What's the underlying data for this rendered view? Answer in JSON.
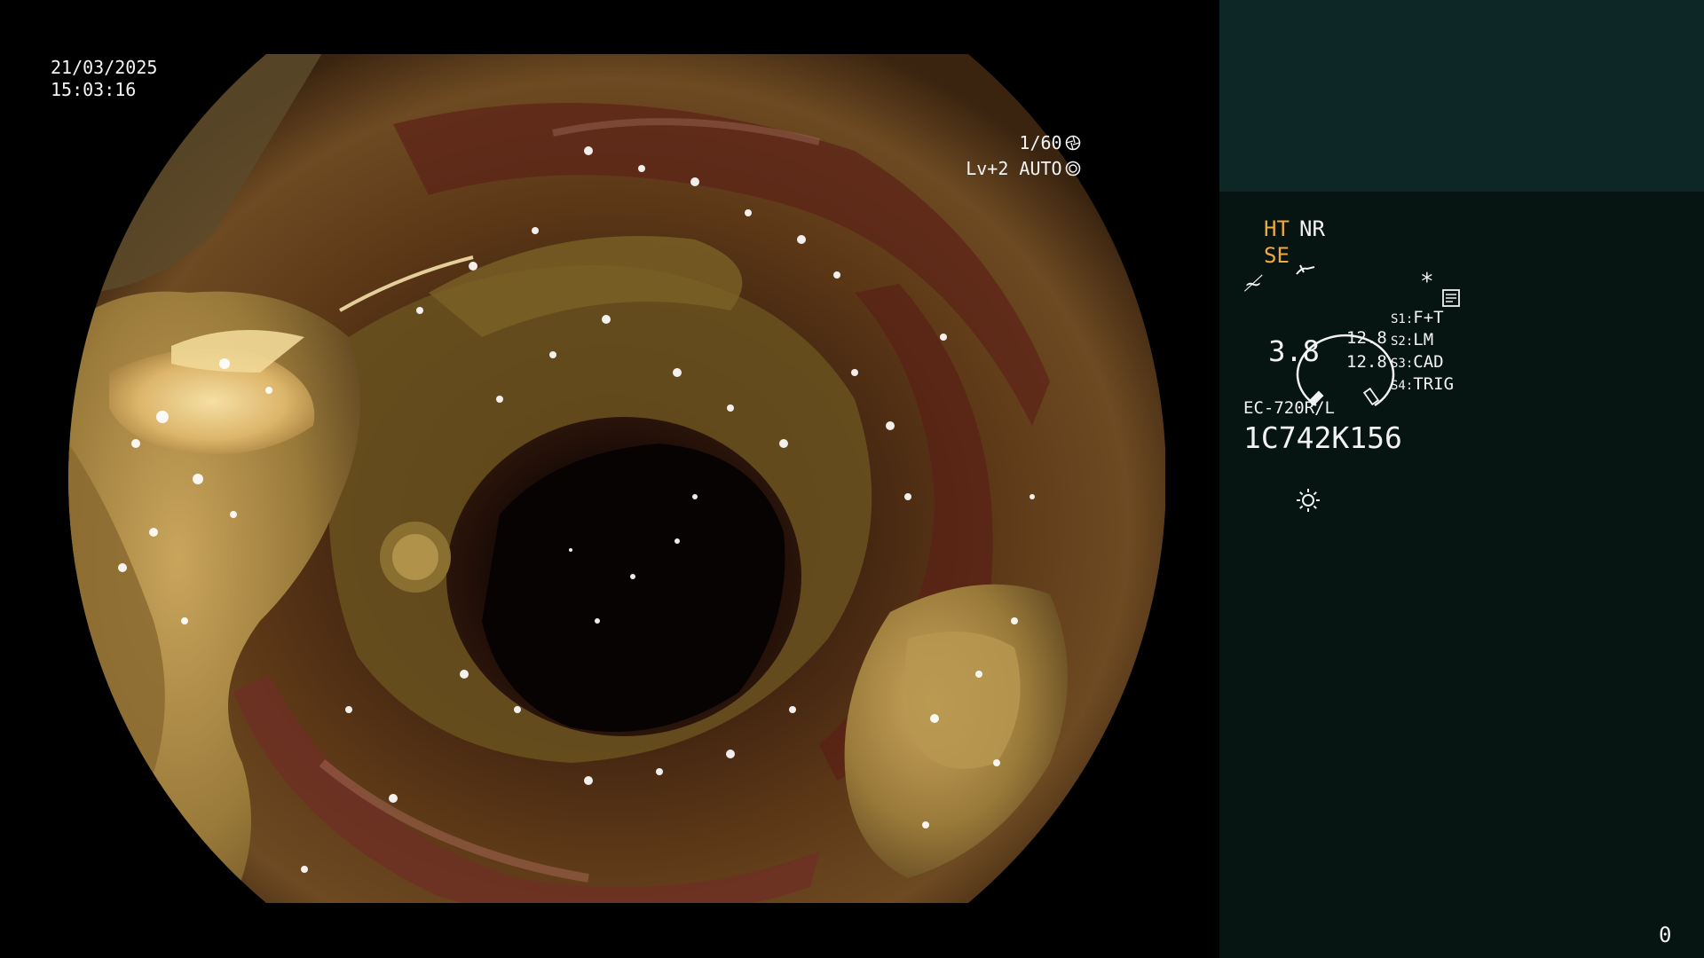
{
  "overlay": {
    "date": "21/03/2025",
    "time": "15:03:16",
    "shutter": "1/60",
    "shutter_icon": "aperture-icon",
    "level": "Lv+2 AUTO",
    "level_icon": "auto-iris-icon"
  },
  "panel": {
    "ht": "HT",
    "nr": "NR",
    "se": "SE",
    "se_icon": "scope-tip-icon",
    "f_symbol": "≁",
    "memo_icon": "memo-icon",
    "asterisk": "*",
    "gauge": {
      "value": "3.8",
      "readout_1": "12.8",
      "readout_2": "12.8"
    },
    "switches": [
      {
        "key": "S1:",
        "value": "F+T"
      },
      {
        "key": "S2:",
        "value": "LM"
      },
      {
        "key": "S3:",
        "value": "CAD"
      },
      {
        "key": "S4:",
        "value": "TRIG"
      }
    ],
    "model": "EC-720R/L",
    "serial": "1C742K156",
    "light_icon": "light-source-icon"
  },
  "counter": "0",
  "colors": {
    "accent_orange": "#f2a93b",
    "panel_bg": "#061412",
    "panel_top_bg": "#0d2626",
    "text": "#f2f2f2"
  }
}
